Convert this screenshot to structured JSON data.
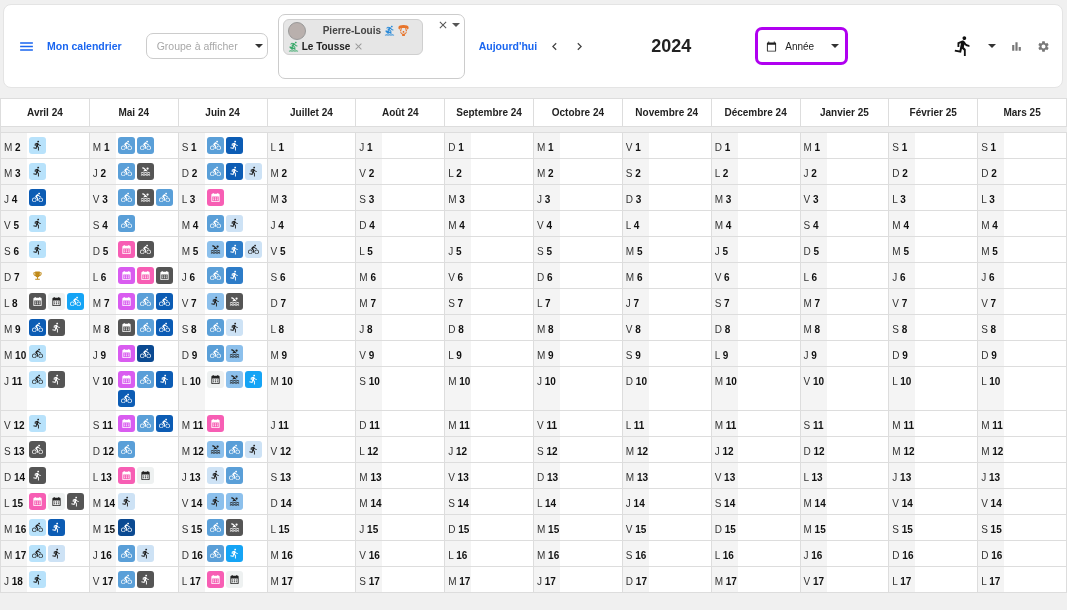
{
  "header": {
    "calendar_link": "Mon calendrier",
    "group_select": {
      "placeholder": "Groupe à afficher"
    },
    "members": [
      {
        "name": "Pierre-Louis"
      },
      {
        "name": "Le Tousse"
      }
    ],
    "today_button": "Aujourd'hui",
    "year": "2024",
    "view_select": {
      "value": "Année"
    }
  },
  "months": [
    {
      "label": "Avril 24",
      "days": [
        {
          "label": "M **2**",
          "events": [
            {
              "kind": "run",
              "color": "#b8e2fb"
            }
          ]
        },
        {
          "label": "M **3**",
          "events": [
            {
              "kind": "run",
              "color": "#b8e2fb"
            }
          ]
        },
        {
          "label": "J **4**",
          "events": [
            {
              "kind": "bike",
              "color": "#0c5cb4"
            }
          ]
        },
        {
          "label": "V **5**",
          "events": [
            {
              "kind": "run",
              "color": "#b8e2fb"
            }
          ]
        },
        {
          "label": "S **6**",
          "events": [
            {
              "kind": "run",
              "color": "#b8e2fb"
            }
          ]
        },
        {
          "label": "D **7**",
          "events": [
            {
              "kind": "trophy",
              "color": "#c08a1a"
            }
          ]
        },
        {
          "label": "L **8**",
          "events": [
            {
              "kind": "calendar",
              "color": "#555555"
            },
            {
              "kind": "calendar",
              "color": "#eef1f1"
            },
            {
              "kind": "bike",
              "color": "#15a4f5"
            }
          ]
        },
        {
          "label": "M **9**",
          "events": [
            {
              "kind": "bike",
              "color": "#0c5cb4"
            },
            {
              "kind": "run",
              "color": "#555555"
            }
          ]
        },
        {
          "label": "M **10**",
          "events": [
            {
              "kind": "bike",
              "color": "#b8e2fb"
            }
          ]
        },
        {
          "label": "J **11**",
          "events": [
            {
              "kind": "bike",
              "color": "#b8e2fb"
            },
            {
              "kind": "run",
              "color": "#555555"
            }
          ]
        },
        {
          "label": "V **12**",
          "events": [
            {
              "kind": "run",
              "color": "#b8e2fb"
            }
          ]
        },
        {
          "label": "S **13**",
          "events": [
            {
              "kind": "bike",
              "color": "#555555"
            }
          ]
        },
        {
          "label": "D **14**",
          "events": [
            {
              "kind": "run",
              "color": "#555555"
            }
          ]
        },
        {
          "label": "L **15**",
          "events": [
            {
              "kind": "calendar",
              "color": "#f75eb4"
            },
            {
              "kind": "calendar",
              "color": "#eef1f1"
            },
            {
              "kind": "run",
              "color": "#555555"
            }
          ]
        },
        {
          "label": "M **16**",
          "events": [
            {
              "kind": "bike",
              "color": "#b8e2fb"
            },
            {
              "kind": "run",
              "color": "#0c5cb4"
            }
          ]
        },
        {
          "label": "M **17**",
          "events": [
            {
              "kind": "bike",
              "color": "#b8e2fb"
            },
            {
              "kind": "run",
              "color": "#cde2f5"
            }
          ]
        },
        {
          "label": "J **18**",
          "events": [
            {
              "kind": "run",
              "color": "#b8e2fb"
            }
          ]
        }
      ]
    },
    {
      "label": "Mai 24",
      "days": [
        {
          "label": "M **1**",
          "events": [
            {
              "kind": "bike",
              "color": "#5a9fd8"
            },
            {
              "kind": "bike",
              "color": "#5a9fd8"
            }
          ]
        },
        {
          "label": "J **2**",
          "events": [
            {
              "kind": "bike",
              "color": "#5a9fd8"
            },
            {
              "kind": "swim",
              "color": "#555555"
            }
          ]
        },
        {
          "label": "V **3**",
          "events": [
            {
              "kind": "bike",
              "color": "#5a9fd8"
            },
            {
              "kind": "swim",
              "color": "#555555"
            },
            {
              "kind": "bike",
              "color": "#5a9fd8"
            }
          ]
        },
        {
          "label": "S **4**",
          "events": [
            {
              "kind": "bike",
              "color": "#5a9fd8"
            }
          ]
        },
        {
          "label": "D **5**",
          "events": [
            {
              "kind": "calendar",
              "color": "#f75eb4"
            },
            {
              "kind": "bike",
              "color": "#555555"
            }
          ]
        },
        {
          "label": "L **6**",
          "events": [
            {
              "kind": "calendar",
              "color": "#d95cf0"
            },
            {
              "kind": "calendar",
              "color": "#f75eb4"
            },
            {
              "kind": "calendar",
              "color": "#555555"
            }
          ]
        },
        {
          "label": "M **7**",
          "events": [
            {
              "kind": "calendar",
              "color": "#d95cf0"
            },
            {
              "kind": "bike",
              "color": "#5a9fd8"
            },
            {
              "kind": "bike",
              "color": "#0c5cb4"
            }
          ]
        },
        {
          "label": "M **8**",
          "events": [
            {
              "kind": "calendar",
              "color": "#555555"
            },
            {
              "kind": "bike",
              "color": "#5a9fd8"
            },
            {
              "kind": "bike",
              "color": "#0c5cb4"
            }
          ]
        },
        {
          "label": "J **9**",
          "events": [
            {
              "kind": "calendar",
              "color": "#d95cf0"
            },
            {
              "kind": "bike",
              "color": "#0b4a92"
            }
          ]
        },
        {
          "label": "V **10**",
          "events": [
            {
              "kind": "calendar",
              "color": "#d95cf0"
            },
            {
              "kind": "bike",
              "color": "#5a9fd8"
            },
            {
              "kind": "run",
              "color": "#0c5cb4"
            },
            {
              "kind": "bike",
              "color": "#0c5cb4"
            }
          ]
        },
        {
          "label": "S **11**",
          "events": [
            {
              "kind": "calendar",
              "color": "#d95cf0"
            },
            {
              "kind": "bike",
              "color": "#5a9fd8"
            },
            {
              "kind": "bike",
              "color": "#0c5cb4"
            }
          ]
        },
        {
          "label": "D **12**",
          "events": [
            {
              "kind": "bike",
              "color": "#5a9fd8"
            }
          ]
        },
        {
          "label": "L **13**",
          "events": [
            {
              "kind": "calendar",
              "color": "#f75eb4"
            },
            {
              "kind": "calendar",
              "color": "#eef1f1"
            }
          ]
        },
        {
          "label": "M **14**",
          "events": [
            {
              "kind": "run",
              "color": "#cde2f5"
            }
          ]
        },
        {
          "label": "M **15**",
          "events": [
            {
              "kind": "bike",
              "color": "#0b4a92"
            }
          ]
        },
        {
          "label": "J **16**",
          "events": [
            {
              "kind": "bike",
              "color": "#5a9fd8"
            },
            {
              "kind": "run",
              "color": "#cde2f5"
            }
          ]
        },
        {
          "label": "V **17**",
          "events": [
            {
              "kind": "bike",
              "color": "#5a9fd8"
            },
            {
              "kind": "run",
              "color": "#555555"
            }
          ]
        }
      ]
    },
    {
      "label": "Juin 24",
      "days": [
        {
          "label": "S **1**",
          "events": [
            {
              "kind": "bike",
              "color": "#5a9fd8"
            },
            {
              "kind": "run",
              "color": "#0c5cb4"
            }
          ]
        },
        {
          "label": "D **2**",
          "events": [
            {
              "kind": "bike",
              "color": "#5a9fd8"
            },
            {
              "kind": "run",
              "color": "#0c5cb4"
            },
            {
              "kind": "run",
              "color": "#cde2f5"
            }
          ]
        },
        {
          "label": "L **3**",
          "events": [
            {
              "kind": "calendar",
              "color": "#f75eb4"
            }
          ]
        },
        {
          "label": "M **4**",
          "events": [
            {
              "kind": "bike",
              "color": "#5a9fd8"
            },
            {
              "kind": "run",
              "color": "#cde2f5"
            }
          ]
        },
        {
          "label": "M **5**",
          "events": [
            {
              "kind": "swim",
              "color": "#8cc0ec"
            },
            {
              "kind": "run",
              "color": "#2d7cc8"
            },
            {
              "kind": "bike",
              "color": "#cde2f5"
            }
          ]
        },
        {
          "label": "J **6**",
          "events": [
            {
              "kind": "bike",
              "color": "#5a9fd8"
            },
            {
              "kind": "run",
              "color": "#2d7cc8"
            }
          ]
        },
        {
          "label": "V **7**",
          "events": [
            {
              "kind": "run",
              "color": "#8cc0ec"
            },
            {
              "kind": "swim",
              "color": "#555555"
            }
          ]
        },
        {
          "label": "S **8**",
          "events": [
            {
              "kind": "bike",
              "color": "#5a9fd8"
            },
            {
              "kind": "run",
              "color": "#cde2f5"
            }
          ]
        },
        {
          "label": "D **9**",
          "events": [
            {
              "kind": "bike",
              "color": "#5a9fd8"
            },
            {
              "kind": "swim",
              "color": "#8cc0ec"
            }
          ]
        },
        {
          "label": "L **10**",
          "events": [
            {
              "kind": "calendar",
              "color": "#eef1f1"
            },
            {
              "kind": "swim",
              "color": "#8cc0ec"
            },
            {
              "kind": "run",
              "color": "#15a4f5"
            }
          ]
        },
        {
          "label": "M **11**",
          "events": [
            {
              "kind": "calendar",
              "color": "#f75eb4"
            }
          ]
        },
        {
          "label": "M **12**",
          "events": [
            {
              "kind": "swim",
              "color": "#8cc0ec"
            },
            {
              "kind": "bike",
              "color": "#5a9fd8"
            },
            {
              "kind": "run",
              "color": "#cde2f5"
            }
          ]
        },
        {
          "label": "J **13**",
          "events": [
            {
              "kind": "run",
              "color": "#cde2f5"
            },
            {
              "kind": "bike",
              "color": "#5a9fd8"
            }
          ]
        },
        {
          "label": "V **14**",
          "events": [
            {
              "kind": "run",
              "color": "#8cc0ec"
            },
            {
              "kind": "swim",
              "color": "#8cc0ec"
            }
          ]
        },
        {
          "label": "S **15**",
          "events": [
            {
              "kind": "bike",
              "color": "#5a9fd8"
            },
            {
              "kind": "swim",
              "color": "#555555"
            }
          ]
        },
        {
          "label": "D **16**",
          "events": [
            {
              "kind": "bike",
              "color": "#5a9fd8"
            },
            {
              "kind": "run",
              "color": "#15a4f5"
            }
          ]
        },
        {
          "label": "L **17**",
          "events": [
            {
              "kind": "calendar",
              "color": "#f75eb4"
            },
            {
              "kind": "calendar",
              "color": "#eef1f1"
            }
          ]
        }
      ]
    },
    {
      "label": "Juillet 24",
      "days": [
        {
          "label": "L **1**"
        },
        {
          "label": "M **2**"
        },
        {
          "label": "M **3**"
        },
        {
          "label": "J **4**"
        },
        {
          "label": "V **5**"
        },
        {
          "label": "S **6**"
        },
        {
          "label": "D **7**"
        },
        {
          "label": "L **8**"
        },
        {
          "label": "M **9**"
        },
        {
          "label": "M **10**"
        },
        {
          "label": "J **11**"
        },
        {
          "label": "V **12**"
        },
        {
          "label": "S **13**"
        },
        {
          "label": "D **14**"
        },
        {
          "label": "L **15**"
        },
        {
          "label": "M **16**"
        },
        {
          "label": "M **17**"
        }
      ]
    },
    {
      "label": "Août 24",
      "days": [
        {
          "label": "J **1**"
        },
        {
          "label": "V **2**"
        },
        {
          "label": "S **3**"
        },
        {
          "label": "D **4**"
        },
        {
          "label": "L **5**"
        },
        {
          "label": "M **6**"
        },
        {
          "label": "M **7**"
        },
        {
          "label": "J **8**"
        },
        {
          "label": "V **9**"
        },
        {
          "label": "S **10**"
        },
        {
          "label": "D **11**"
        },
        {
          "label": "L **12**"
        },
        {
          "label": "M **13**"
        },
        {
          "label": "M **14**"
        },
        {
          "label": "J **15**"
        },
        {
          "label": "V **16**"
        },
        {
          "label": "S **17**"
        }
      ]
    },
    {
      "label": "Septembre 24",
      "days": [
        {
          "label": "D **1**"
        },
        {
          "label": "L **2**"
        },
        {
          "label": "M **3**"
        },
        {
          "label": "M **4**"
        },
        {
          "label": "J **5**"
        },
        {
          "label": "V **6**"
        },
        {
          "label": "S **7**"
        },
        {
          "label": "D **8**"
        },
        {
          "label": "L **9**"
        },
        {
          "label": "M **10**"
        },
        {
          "label": "M **11**"
        },
        {
          "label": "J **12**"
        },
        {
          "label": "V **13**"
        },
        {
          "label": "S **14**"
        },
        {
          "label": "D **15**"
        },
        {
          "label": "L **16**"
        },
        {
          "label": "M **17**"
        }
      ]
    },
    {
      "label": "Octobre 24",
      "days": [
        {
          "label": "M **1**"
        },
        {
          "label": "M **2**"
        },
        {
          "label": "J **3**"
        },
        {
          "label": "V **4**"
        },
        {
          "label": "S **5**"
        },
        {
          "label": "D **6**"
        },
        {
          "label": "L **7**"
        },
        {
          "label": "M **8**"
        },
        {
          "label": "M **9**"
        },
        {
          "label": "J **10**"
        },
        {
          "label": "V **11**"
        },
        {
          "label": "S **12**"
        },
        {
          "label": "D **13**"
        },
        {
          "label": "L **14**"
        },
        {
          "label": "M **15**"
        },
        {
          "label": "M **16**"
        },
        {
          "label": "J **17**"
        }
      ]
    },
    {
      "label": "Novembre 24",
      "days": [
        {
          "label": "V **1**"
        },
        {
          "label": "S **2**"
        },
        {
          "label": "D **3**"
        },
        {
          "label": "L **4**"
        },
        {
          "label": "M **5**"
        },
        {
          "label": "M **6**"
        },
        {
          "label": "J **7**"
        },
        {
          "label": "V **8**"
        },
        {
          "label": "S **9**"
        },
        {
          "label": "D **10**"
        },
        {
          "label": "L **11**"
        },
        {
          "label": "M **12**"
        },
        {
          "label": "M **13**"
        },
        {
          "label": "J **14**"
        },
        {
          "label": "V **15**"
        },
        {
          "label": "S **16**"
        },
        {
          "label": "D **17**"
        }
      ]
    },
    {
      "label": "Décembre 24",
      "days": [
        {
          "label": "D **1**"
        },
        {
          "label": "L **2**"
        },
        {
          "label": "M **3**"
        },
        {
          "label": "M **4**"
        },
        {
          "label": "J **5**"
        },
        {
          "label": "V **6**"
        },
        {
          "label": "S **7**"
        },
        {
          "label": "D **8**"
        },
        {
          "label": "L **9**"
        },
        {
          "label": "M **10**"
        },
        {
          "label": "M **11**"
        },
        {
          "label": "J **12**"
        },
        {
          "label": "V **13**"
        },
        {
          "label": "S **14**"
        },
        {
          "label": "D **15**"
        },
        {
          "label": "L **16**"
        },
        {
          "label": "M **17**"
        }
      ]
    },
    {
      "label": "Janvier 25",
      "days": [
        {
          "label": "M **1**"
        },
        {
          "label": "J **2**"
        },
        {
          "label": "V **3**"
        },
        {
          "label": "S **4**"
        },
        {
          "label": "D **5**"
        },
        {
          "label": "L **6**"
        },
        {
          "label": "M **7**"
        },
        {
          "label": "M **8**"
        },
        {
          "label": "J **9**"
        },
        {
          "label": "V **10**"
        },
        {
          "label": "S **11**"
        },
        {
          "label": "D **12**"
        },
        {
          "label": "L **13**"
        },
        {
          "label": "M **14**"
        },
        {
          "label": "M **15**"
        },
        {
          "label": "J **16**"
        },
        {
          "label": "V **17**"
        }
      ]
    },
    {
      "label": "Février 25",
      "days": [
        {
          "label": "S **1**"
        },
        {
          "label": "D **2**"
        },
        {
          "label": "L **3**"
        },
        {
          "label": "M **4**"
        },
        {
          "label": "M **5**"
        },
        {
          "label": "J **6**"
        },
        {
          "label": "V **7**"
        },
        {
          "label": "S **8**"
        },
        {
          "label": "D **9**"
        },
        {
          "label": "L **10**"
        },
        {
          "label": "M **11**"
        },
        {
          "label": "M **12**"
        },
        {
          "label": "J **13**"
        },
        {
          "label": "V **14**"
        },
        {
          "label": "S **15**"
        },
        {
          "label": "D **16**"
        },
        {
          "label": "L **17**"
        }
      ]
    },
    {
      "label": "Mars 25",
      "days": [
        {
          "label": "S **1**"
        },
        {
          "label": "D **2**"
        },
        {
          "label": "L **3**"
        },
        {
          "label": "M **4**"
        },
        {
          "label": "M **5**"
        },
        {
          "label": "J **6**"
        },
        {
          "label": "V **7**"
        },
        {
          "label": "S **8**"
        },
        {
          "label": "D **9**"
        },
        {
          "label": "L **10**"
        },
        {
          "label": "M **11**"
        },
        {
          "label": "M **12**"
        },
        {
          "label": "J **13**"
        },
        {
          "label": "V **14**"
        },
        {
          "label": "S **15**"
        },
        {
          "label": "D **16**"
        },
        {
          "label": "L **17**"
        }
      ]
    }
  ]
}
